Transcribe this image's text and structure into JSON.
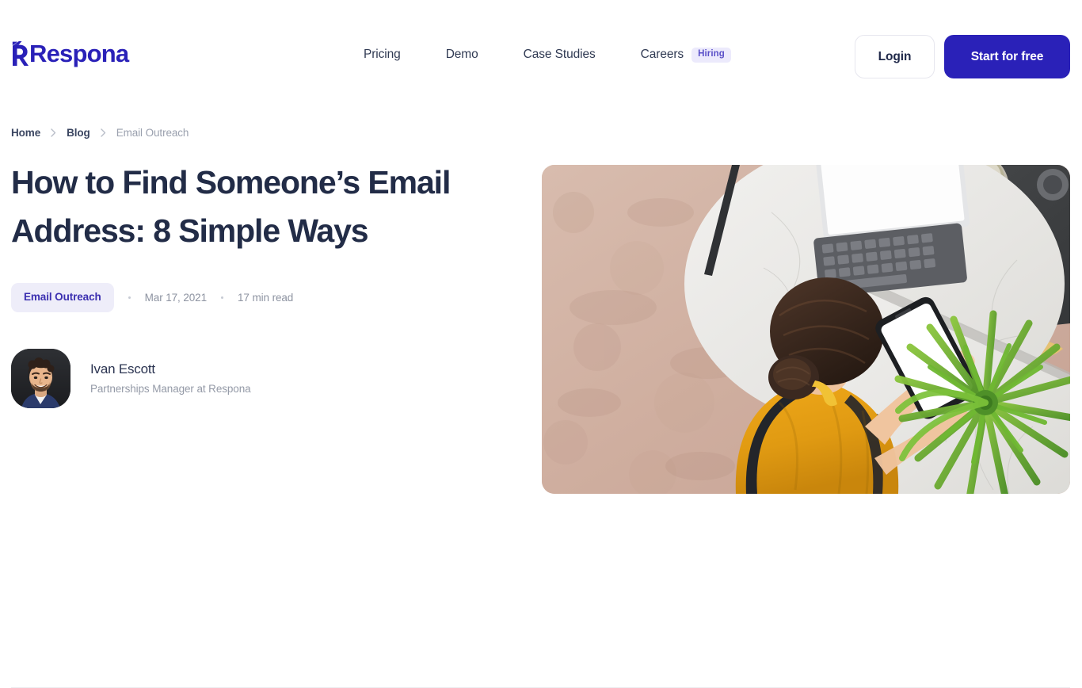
{
  "brand": {
    "name": "Respona",
    "primary_color": "#2a21b8",
    "logo_icon": "respona-r-logo"
  },
  "header": {
    "nav": [
      {
        "label": "Pricing",
        "badge": null,
        "name": "pricing"
      },
      {
        "label": "Demo",
        "badge": null,
        "name": "demo"
      },
      {
        "label": "Case Studies",
        "badge": null,
        "name": "case-studies"
      },
      {
        "label": "Careers",
        "badge": "Hiring",
        "name": "careers"
      }
    ],
    "login_label": "Login",
    "cta_label": "Start for free",
    "badge_bg": "#eceafc",
    "badge_color": "#5a50c8"
  },
  "breadcrumb": {
    "items": [
      {
        "label": "Home",
        "current": false
      },
      {
        "label": "Blog",
        "current": false
      },
      {
        "label": "Email Outreach",
        "current": true
      }
    ],
    "separator": "›"
  },
  "post": {
    "title": "How to Find Someone’s Email Address: 8 Simple Ways",
    "category_tag": "Email Outreach",
    "date": "Mar 17, 2021",
    "read_time": "17 min read",
    "tag_bg": "#eeedf9",
    "tag_color": "#3b2fb0"
  },
  "author": {
    "name": "Ivan Escott",
    "title": "Partnerships Manager at Respona",
    "avatar_alt": "author-avatar-photo"
  },
  "hero_image": {
    "alt": "Top-down photo of a woman in a yellow top at a marble table using a smartphone next to a laptop and a green plant"
  }
}
